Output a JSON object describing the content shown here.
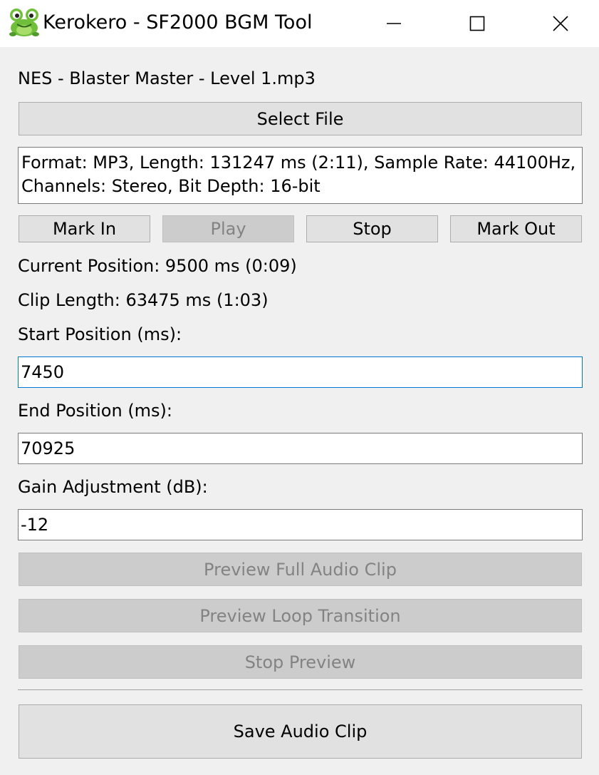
{
  "window": {
    "title": "Kerokero - SF2000 BGM Tool",
    "icon": "frog-icon",
    "controls": [
      "minimize-icon",
      "maximize-icon",
      "close-icon"
    ]
  },
  "file": {
    "name": "NES - Blaster Master - Level 1.mp3",
    "select_label": "Select File"
  },
  "info": {
    "line1": "Format: MP3, Length: 131247 ms (2:11), Sample Rate: 44100Hz,",
    "line2": "Channels: Stereo, Bit Depth: 16-bit"
  },
  "transport": {
    "mark_in": "Mark In",
    "play": "Play",
    "stop": "Stop",
    "mark_out": "Mark Out",
    "play_enabled": false
  },
  "status": {
    "current_position": "Current Position: 9500 ms (0:09)",
    "clip_length": "Clip Length: 63475 ms (1:03)"
  },
  "fields": {
    "start_label": "Start Position (ms):",
    "start_value": "7450",
    "end_label": "End Position (ms):",
    "end_value": "70925",
    "gain_label": "Gain Adjustment (dB):",
    "gain_value": "-12"
  },
  "preview": {
    "full": "Preview Full Audio Clip",
    "loop": "Preview Loop Transition",
    "stop": "Stop Preview",
    "enabled": false
  },
  "save_label": "Save Audio Clip",
  "colors": {
    "window_bg": "#f0f0f0",
    "button_bg": "#e1e1e1",
    "disabled_bg": "#cccccc",
    "disabled_text": "#838383",
    "focus_border": "#0078d7"
  }
}
